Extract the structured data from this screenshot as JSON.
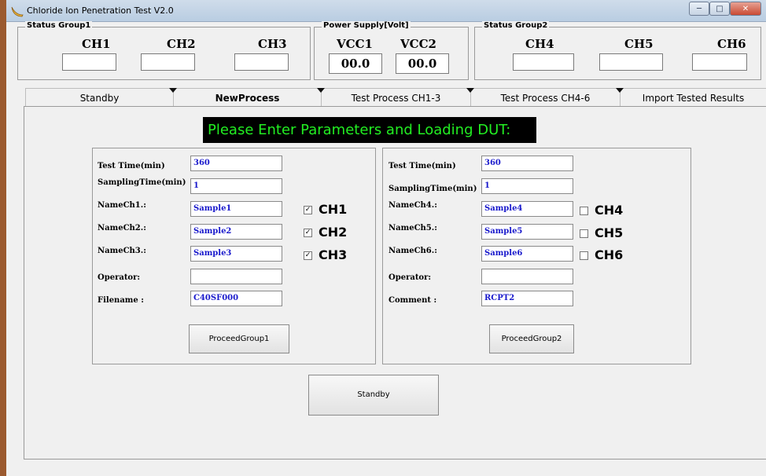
{
  "window": {
    "title": "Chloride Ion Penetration Test V2.0",
    "controls": {
      "minimize": "─",
      "maximize": "□",
      "close": "✕"
    }
  },
  "status_group1": {
    "legend": "Status Group1",
    "channels": [
      "CH1",
      "CH2",
      "CH3"
    ]
  },
  "power_supply": {
    "legend": "Power Supply[Volt]",
    "vcc1_label": "VCC1",
    "vcc2_label": "VCC2",
    "vcc1_value": "00.0",
    "vcc2_value": "00.0"
  },
  "status_group2": {
    "legend": "Status Group2",
    "channels": [
      "CH4",
      "CH5",
      "CH6"
    ]
  },
  "tabs": [
    "Standby",
    "NewProcess",
    "Test Process CH1-3",
    "Test Process CH4-6",
    "Import Tested Results"
  ],
  "active_tab": "NewProcess",
  "banner": "Please Enter Parameters and Loading DUT:",
  "group1": {
    "test_time_label": "Test Time(min)",
    "test_time": "360",
    "sampling_label": "SamplingTime(min)",
    "sampling": "1",
    "name1_label": "NameCh1.:",
    "name1": "Sample1",
    "name2_label": "NameCh2.:",
    "name2": "Sample2",
    "name3_label": "NameCh3.:",
    "name3": "Sample3",
    "operator_label": "Operator:",
    "operator": "",
    "filename_label": "Filename :",
    "filename": "C40SF000",
    "check1": "CH1",
    "check2": "CH2",
    "check3": "CH3",
    "check_mark": "✓",
    "proceed": "ProceedGroup1"
  },
  "group2": {
    "test_time_label": "Test Time(min)",
    "test_time": "360",
    "sampling_label": "SamplingTime(min)",
    "sampling": "1",
    "name4_label": "NameCh4.:",
    "name4": "Sample4",
    "name5_label": "NameCh5.:",
    "name5": "Sample5",
    "name6_label": "NameCh6.:",
    "name6": "Sample6",
    "operator_label": "Operator:",
    "operator": "",
    "comment_label": "Comment :",
    "comment": "RCPT2",
    "check4": "CH4",
    "check5": "CH5",
    "check6": "CH6",
    "proceed": "ProceedGroup2"
  },
  "standby_button": "Standby"
}
